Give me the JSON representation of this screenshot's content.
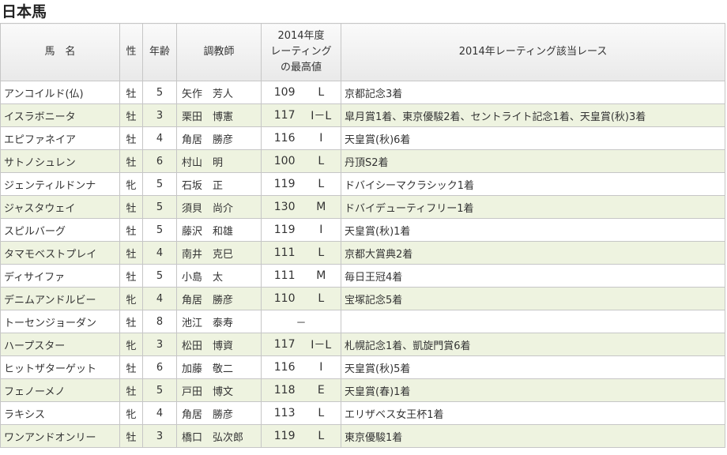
{
  "page": {
    "title": "日本馬"
  },
  "table": {
    "headers": {
      "name": "馬　名",
      "sex": "性",
      "age": "年齢",
      "trainer": "調教師",
      "rating_line1": "2014年度",
      "rating_line2": "レーティング",
      "rating_line3": "の最高値",
      "race": "2014年レーティング該当レース"
    },
    "rows": [
      {
        "name": "アンコイルド(仏)",
        "sex": "牡",
        "age": "5",
        "trainer": "矢作　芳人",
        "rating": "109",
        "cls": "L",
        "race": "京都記念3着"
      },
      {
        "name": "イスラボニータ",
        "sex": "牡",
        "age": "3",
        "trainer": "栗田　博憲",
        "rating": "117",
        "cls": "I－L",
        "race": "皐月賞1着、東京優駿2着、セントライト記念1着、天皇賞(秋)3着"
      },
      {
        "name": "エピファネイア",
        "sex": "牡",
        "age": "4",
        "trainer": "角居　勝彦",
        "rating": "116",
        "cls": "I",
        "race": "天皇賞(秋)6着"
      },
      {
        "name": "サトノシュレン",
        "sex": "牡",
        "age": "6",
        "trainer": "村山　明",
        "rating": "100",
        "cls": "L",
        "race": "丹頂S2着"
      },
      {
        "name": "ジェンティルドンナ",
        "sex": "牝",
        "age": "5",
        "trainer": "石坂　正",
        "rating": "119",
        "cls": "L",
        "race": "ドバイシーマクラシック1着"
      },
      {
        "name": "ジャスタウェイ",
        "sex": "牡",
        "age": "5",
        "trainer": "須貝　尚介",
        "rating": "130",
        "cls": "M",
        "race": "ドバイデューティフリー1着"
      },
      {
        "name": "スピルバーグ",
        "sex": "牡",
        "age": "5",
        "trainer": "藤沢　和雄",
        "rating": "119",
        "cls": "I",
        "race": "天皇賞(秋)1着"
      },
      {
        "name": "タマモベストプレイ",
        "sex": "牡",
        "age": "4",
        "trainer": "南井　克巳",
        "rating": "111",
        "cls": "L",
        "race": "京都大賞典2着"
      },
      {
        "name": "ディサイファ",
        "sex": "牡",
        "age": "5",
        "trainer": "小島　太",
        "rating": "111",
        "cls": "M",
        "race": "毎日王冠4着"
      },
      {
        "name": "デニムアンドルビー",
        "sex": "牝",
        "age": "4",
        "trainer": "角居　勝彦",
        "rating": "110",
        "cls": "L",
        "race": "宝塚記念5着"
      },
      {
        "name": "トーセンジョーダン",
        "sex": "牡",
        "age": "8",
        "trainer": "池江　泰寿",
        "rating": "",
        "cls": "",
        "dash": "－",
        "race": ""
      },
      {
        "name": "ハープスター",
        "sex": "牝",
        "age": "3",
        "trainer": "松田　博資",
        "rating": "117",
        "cls": "I－L",
        "race": "札幌記念1着、凱旋門賞6着"
      },
      {
        "name": "ヒットザターゲット",
        "sex": "牡",
        "age": "6",
        "trainer": "加藤　敬二",
        "rating": "116",
        "cls": "I",
        "race": "天皇賞(秋)5着"
      },
      {
        "name": "フェノーメノ",
        "sex": "牡",
        "age": "5",
        "trainer": "戸田　博文",
        "rating": "118",
        "cls": "E",
        "race": "天皇賞(春)1着"
      },
      {
        "name": "ラキシス",
        "sex": "牝",
        "age": "4",
        "trainer": "角居　勝彦",
        "rating": "113",
        "cls": "L",
        "race": "エリザベス女王杯1着"
      },
      {
        "name": "ワンアンドオンリー",
        "sex": "牡",
        "age": "3",
        "trainer": "橋口　弘次郎",
        "rating": "119",
        "cls": "L",
        "race": "東京優駿1着"
      }
    ]
  }
}
